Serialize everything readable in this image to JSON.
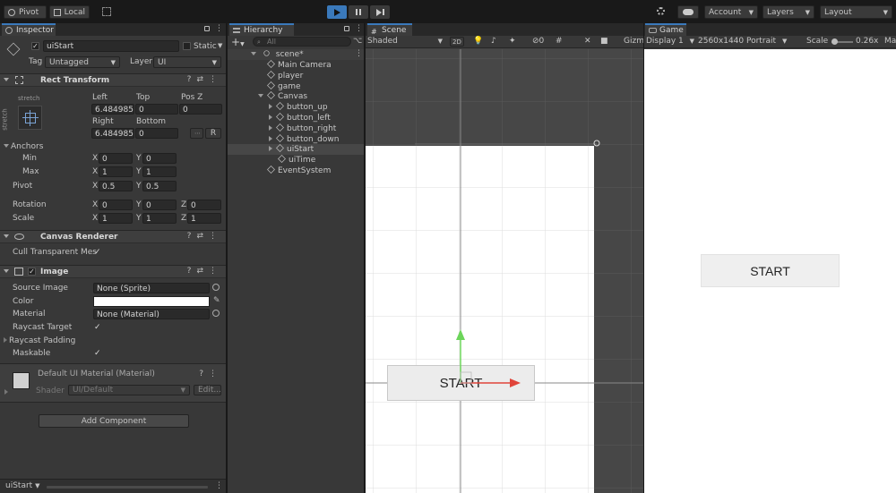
{
  "toolbar": {
    "pivot_label": "Pivot",
    "local_label": "Local",
    "account_label": "Account",
    "layers_label": "Layers",
    "layout_label": "Layout"
  },
  "inspector": {
    "tab_label": "Inspector",
    "object_name": "uiStart",
    "static_label": "Static",
    "tag_label": "Tag",
    "tag_value": "Untagged",
    "layer_label": "Layer",
    "layer_value": "UI",
    "rect_transform": {
      "title": "Rect Transform",
      "stretch_label": "stretch",
      "stretch_side_label": "stretch",
      "left_label": "Left",
      "top_label": "Top",
      "posz_label": "Pos Z",
      "left_value": "6.484985e",
      "top_value": "0",
      "posz_value": "0",
      "right_label": "Right",
      "bottom_label": "Bottom",
      "right_value": "6.484985e",
      "bottom_value": "0",
      "r_button": "R",
      "anchors_label": "Anchors",
      "min_label": "Min",
      "max_label": "Max",
      "min_x": "0",
      "min_y": "0",
      "max_x": "1",
      "max_y": "1",
      "pivot_label": "Pivot",
      "pivot_x": "0.5",
      "pivot_y": "0.5",
      "rotation_label": "Rotation",
      "rot_x": "0",
      "rot_y": "0",
      "rot_z": "0",
      "scale_label": "Scale",
      "scale_x": "1",
      "scale_y": "1",
      "scale_z": "1",
      "x": "X",
      "y": "Y",
      "z": "Z"
    },
    "canvas_renderer": {
      "title": "Canvas Renderer",
      "cull_label": "Cull Transparent Mes"
    },
    "image": {
      "title": "Image",
      "source_label": "Source Image",
      "source_value": "None (Sprite)",
      "color_label": "Color",
      "material_label": "Material",
      "material_value": "None (Material)",
      "raycast_target_label": "Raycast Target",
      "raycast_padding_label": "Raycast Padding",
      "maskable_label": "Maskable"
    },
    "material_block": {
      "title": "Default UI Material (Material)",
      "shader_label": "Shader",
      "shader_value": "UI/Default",
      "edit_label": "Edit..."
    },
    "add_component_label": "Add Component",
    "footer_label": "uiStart"
  },
  "hierarchy": {
    "tab_label": "Hierarchy",
    "search_placeholder": "All",
    "scene_name": "scene*",
    "items": [
      {
        "label": "Main Camera",
        "depth": 1,
        "arrow": ""
      },
      {
        "label": "player",
        "depth": 1,
        "arrow": ""
      },
      {
        "label": "game",
        "depth": 1,
        "arrow": ""
      },
      {
        "label": "Canvas",
        "depth": 1,
        "arrow": "down"
      },
      {
        "label": "button_up",
        "depth": 2,
        "arrow": "right"
      },
      {
        "label": "button_left",
        "depth": 2,
        "arrow": "right"
      },
      {
        "label": "button_right",
        "depth": 2,
        "arrow": "right"
      },
      {
        "label": "button_down",
        "depth": 2,
        "arrow": "right"
      },
      {
        "label": "uiStart",
        "depth": 2,
        "arrow": "right",
        "selected": true
      },
      {
        "label": "uiTime",
        "depth": 2,
        "arrow": ""
      },
      {
        "label": "EventSystem",
        "depth": 1,
        "arrow": ""
      }
    ]
  },
  "scene": {
    "tab_label": "Scene",
    "shading_mode": "Shaded",
    "mode_2d": "2D",
    "hidden_count": "0",
    "gizmos_label": "Gizm",
    "button_text": "START"
  },
  "game": {
    "tab_label": "Game",
    "display_label": "Display 1",
    "resolution_label": "2560x1440 Portrait",
    "scale_label": "Scale",
    "scale_value": "0.26x",
    "maximize_label": "Ma",
    "button_text": "START"
  },
  "colors": {
    "accent": "#3a79bb",
    "play_active": "#3a79bb",
    "selected_row": "#474747",
    "y_axis_gizmo": "#6cd55a",
    "x_axis_gizmo": "#e0443a"
  }
}
